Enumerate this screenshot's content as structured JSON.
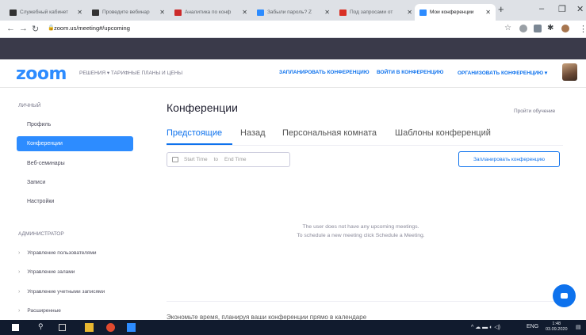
{
  "browser": {
    "tabs": [
      {
        "label": "Служебный кабинет",
        "favicon_color": "#333333"
      },
      {
        "label": "Проведите вебинар",
        "favicon_color": "#333333"
      },
      {
        "label": "Аналитика по конф",
        "favicon_color": "#cc2b2b"
      },
      {
        "label": "Забыли пароль? Z",
        "favicon_color": "#2d8cff"
      },
      {
        "label": "Под запросами от",
        "favicon_color": "#d93025"
      },
      {
        "label": "Мои конференции",
        "favicon_color": "#2d8cff"
      }
    ],
    "url": "zoom.us/meeting#/upcoming"
  },
  "header": {
    "logo": "zoom",
    "nav": "РЕШЕНИЯ ▾   ТАРИФНЫЕ ПЛАНЫ И ЦЕНЫ",
    "schedule_link": "ЗАПЛАНИРОВАТЬ КОНФЕРЕНЦИЮ",
    "join_link": "ВОЙТИ В КОНФЕРЕНЦИЮ",
    "host_link": "ОРГАНИЗОВАТЬ КОНФЕРЕНЦИЮ ▾"
  },
  "sidebar": {
    "personal_heading": "ЛИЧНЫЙ",
    "personal_items": [
      {
        "label": "Профиль"
      },
      {
        "label": "Конференции",
        "active": true
      },
      {
        "label": "Веб-семинары"
      },
      {
        "label": "Записи"
      },
      {
        "label": "Настройки"
      }
    ],
    "admin_heading": "АДМИНИСТРАТОР",
    "admin_items": [
      {
        "label": "Управление пользователями"
      },
      {
        "label": "Управление залами"
      },
      {
        "label": "Управление учетными записями"
      },
      {
        "label": "Расширенные"
      }
    ]
  },
  "main": {
    "title": "Конференции",
    "learn_link": "Пройти обучение",
    "tabs": [
      {
        "label": "Предстоящие",
        "active": true
      },
      {
        "label": "Назад"
      },
      {
        "label": "Персональная комната"
      },
      {
        "label": "Шаблоны конференций"
      }
    ],
    "date_start_placeholder": "Start Time",
    "date_to": "to",
    "date_end_placeholder": "End Time",
    "schedule_button": "Запланировать конференцию",
    "empty_line1": "The user does not have any upcoming meetings.",
    "empty_line2": "To schedule a new meeting click Schedule a Meeting.",
    "promo": "Экономьте время, планируя ваши конференции прямо в календаре"
  },
  "taskbar": {
    "lang": "ENG",
    "time": "1:48",
    "date": "03.09.2020"
  },
  "colors": {
    "accent": "#2d8cff",
    "link": "#0e72ed",
    "dark_band": "#3a3a4a",
    "taskbar": "#111b2e"
  }
}
